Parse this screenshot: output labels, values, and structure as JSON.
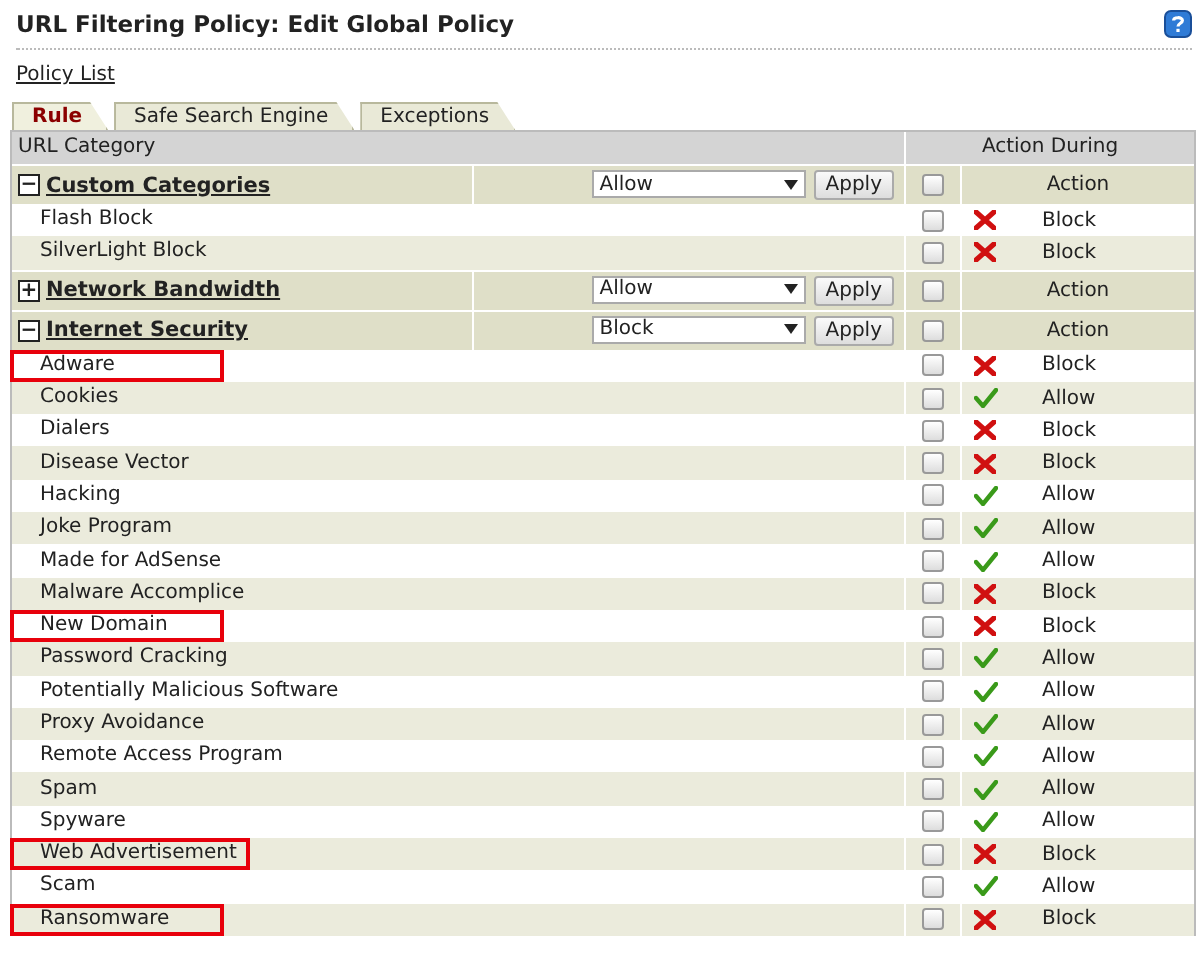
{
  "title": "URL Filtering Policy: Edit Global Policy",
  "breadcrumb": "Policy List",
  "tabs": [
    {
      "label": "Rule",
      "selected": true
    },
    {
      "label": "Safe Search Engine",
      "selected": false
    },
    {
      "label": "Exceptions",
      "selected": false
    }
  ],
  "table": {
    "columns": [
      "URL Category",
      "Action During"
    ],
    "groups": [
      {
        "name": "Custom Categories",
        "expanded": true,
        "expander": "−",
        "select_value": "Allow",
        "apply": "Apply",
        "checked": false,
        "action_header": "Action",
        "items": [
          {
            "name": "Flash Block",
            "checked": false,
            "blocked": true,
            "action": "Block",
            "highlighted": false
          },
          {
            "name": "SilverLight Block",
            "checked": false,
            "blocked": true,
            "action": "Block",
            "highlighted": false
          }
        ]
      },
      {
        "name": "Network Bandwidth",
        "expanded": false,
        "expander": "+",
        "select_value": "Allow",
        "apply": "Apply",
        "checked": false,
        "action_header": "Action"
      },
      {
        "name": "Internet Security",
        "expanded": true,
        "expander": "−",
        "select_value": "Block",
        "apply": "Apply",
        "checked": false,
        "action_header": "Action",
        "items": [
          {
            "name": "Adware",
            "checked": false,
            "blocked": true,
            "action": "Block",
            "highlighted": true
          },
          {
            "name": "Cookies",
            "checked": false,
            "blocked": false,
            "action": "Allow",
            "highlighted": false
          },
          {
            "name": "Dialers",
            "checked": false,
            "blocked": true,
            "action": "Block",
            "highlighted": false
          },
          {
            "name": "Disease Vector",
            "checked": false,
            "blocked": true,
            "action": "Block",
            "highlighted": false
          },
          {
            "name": "Hacking",
            "checked": false,
            "blocked": false,
            "action": "Allow",
            "highlighted": false
          },
          {
            "name": "Joke Program",
            "checked": false,
            "blocked": false,
            "action": "Allow",
            "highlighted": false
          },
          {
            "name": "Made for AdSense",
            "checked": false,
            "blocked": false,
            "action": "Allow",
            "highlighted": false
          },
          {
            "name": "Malware Accomplice",
            "checked": false,
            "blocked": true,
            "action": "Block",
            "highlighted": false
          },
          {
            "name": "New Domain",
            "checked": false,
            "blocked": true,
            "action": "Block",
            "highlighted": true
          },
          {
            "name": "Password Cracking",
            "checked": false,
            "blocked": false,
            "action": "Allow",
            "highlighted": false
          },
          {
            "name": "Potentially Malicious Software",
            "checked": false,
            "blocked": false,
            "action": "Allow",
            "highlighted": false
          },
          {
            "name": "Proxy Avoidance",
            "checked": false,
            "blocked": false,
            "action": "Allow",
            "highlighted": false
          },
          {
            "name": "Remote Access Program",
            "checked": false,
            "blocked": false,
            "action": "Allow",
            "highlighted": false
          },
          {
            "name": "Spam",
            "checked": false,
            "blocked": false,
            "action": "Allow",
            "highlighted": false
          },
          {
            "name": "Spyware",
            "checked": false,
            "blocked": false,
            "action": "Allow",
            "highlighted": false
          },
          {
            "name": "Web Advertisement",
            "checked": false,
            "blocked": true,
            "action": "Block",
            "highlighted": true
          },
          {
            "name": "Scam",
            "checked": false,
            "blocked": false,
            "action": "Allow",
            "highlighted": false
          },
          {
            "name": "Ransomware",
            "checked": false,
            "blocked": true,
            "action": "Block",
            "highlighted": true
          }
        ]
      }
    ]
  }
}
